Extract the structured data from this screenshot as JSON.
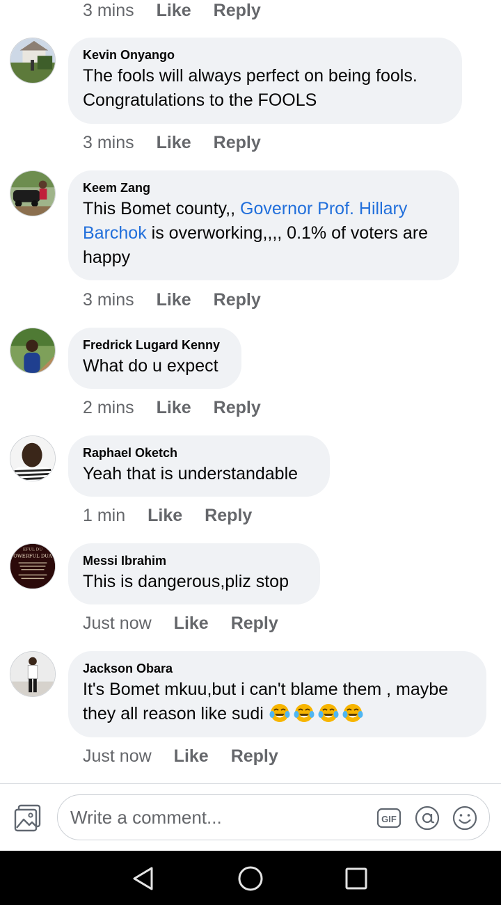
{
  "top_meta": {
    "time": "3 mins",
    "like": "Like",
    "reply": "Reply"
  },
  "comments": [
    {
      "author": "Kevin Onyango",
      "text_lines": [
        "The fools will always perfect on being fools.",
        "Congratulations to the FOOLS"
      ],
      "time": "3 mins",
      "like": "Like",
      "reply": "Reply"
    },
    {
      "author": "Keem Zang",
      "text_before": "This Bomet county,, ",
      "mention": "Governor Prof. Hillary Barchok",
      "text_after": " is overworking,,,, 0.1% of voters are happy",
      "time": "3 mins",
      "like": "Like",
      "reply": "Reply"
    },
    {
      "author": "Fredrick Lugard Kenny",
      "text": "What do u expect",
      "time": "2 mins",
      "like": "Like",
      "reply": "Reply"
    },
    {
      "author": "Raphael Oketch",
      "text": "Yeah that is understandable",
      "time": "1 min",
      "like": "Like",
      "reply": "Reply"
    },
    {
      "author": "Messi Ibrahim",
      "text": "This is dangerous,pliz stop",
      "time": "Just now",
      "like": "Like",
      "reply": "Reply",
      "avatar_text": [
        "EFUL DU",
        "OWERFUL DUA"
      ]
    },
    {
      "author": "Jackson Obara",
      "text_lines": [
        "It's Bomet mkuu,but i can't blame them , maybe",
        "they all reason like sudi"
      ],
      "emojis": [
        "tears-of-joy",
        "tears-of-joy",
        "tears-of-joy",
        "tears-of-joy"
      ],
      "time": "Just now",
      "like": "Like",
      "reply": "Reply"
    }
  ],
  "composer": {
    "placeholder": "Write a comment...",
    "gif_label": "GIF",
    "icons": [
      "photo-icon",
      "gif-icon",
      "mention-at-icon",
      "emoji-icon"
    ]
  },
  "navbar": {
    "icons": [
      "back-triangle-icon",
      "home-circle-icon",
      "recents-square-icon"
    ]
  },
  "colors": {
    "bubble": "#f0f2f5",
    "mention": "#216fdb",
    "meta": "#65676b",
    "navbar": "#000000"
  }
}
